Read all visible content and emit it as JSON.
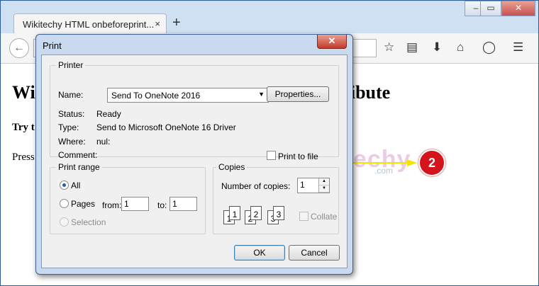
{
  "browser": {
    "tab_title": "Wikitechy HTML onbeforeprint...",
    "tab_close": "×",
    "new_tab": "+",
    "window_buttons": [
      "‒",
      "▭",
      "✕"
    ],
    "icons": [
      "star-icon",
      "reading-list-icon",
      "download-icon",
      "home-icon",
      "pocket-icon",
      "menu-icon"
    ]
  },
  "page": {
    "heading_left": "Wi",
    "heading_right": "ttribute",
    "try_text": "Try t",
    "press_text": "Press"
  },
  "watermark": {
    "text": "Wikitechy",
    "suffix": ".com"
  },
  "annotation": {
    "badge": "2",
    "color": "#d4141a",
    "arrow_color": "#f2e600"
  },
  "dialog": {
    "title": "Print",
    "close": "✕",
    "printer": {
      "legend": "Printer",
      "name_label": "Name:",
      "name_value": "Send To OneNote 2016",
      "properties_button": "Properties...",
      "status_label": "Status:",
      "status_value": "Ready",
      "type_label": "Type:",
      "type_value": "Send to Microsoft OneNote 16 Driver",
      "where_label": "Where:",
      "where_value": "nul:",
      "comment_label": "Comment:",
      "print_to_file": "Print to file"
    },
    "print_range": {
      "legend": "Print range",
      "all": "All",
      "pages": "Pages",
      "from_label": "from:",
      "from_value": "1",
      "to_label": "to:",
      "to_value": "1",
      "selection": "Selection",
      "selected": "All"
    },
    "copies": {
      "legend": "Copies",
      "number_label": "Number of copies:",
      "number_value": "1",
      "collate": "Collate",
      "collate_checked": false
    },
    "ok_button": "OK",
    "cancel_button": "Cancel"
  }
}
